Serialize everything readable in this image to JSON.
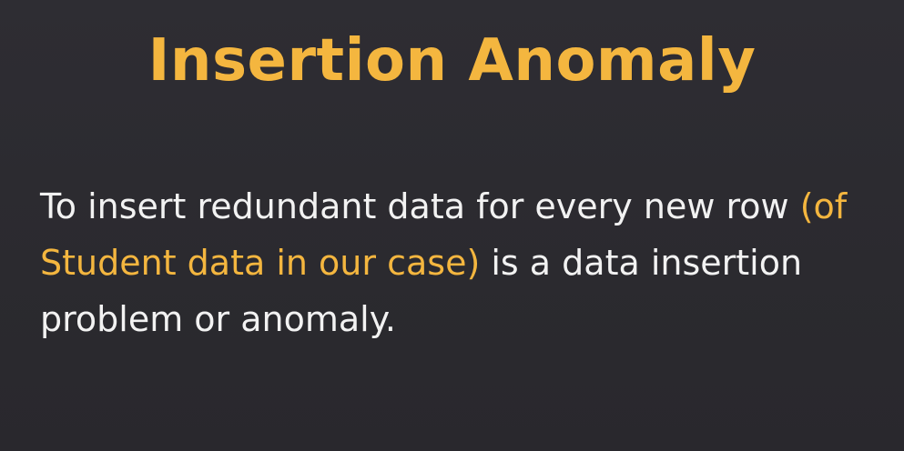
{
  "colors": {
    "background": "#2c2b30",
    "title": "#f4b63f",
    "body": "#f2f2f2",
    "highlight": "#f4b63f"
  },
  "slide": {
    "title": "Insertion Anomaly",
    "body_part1": "To insert redundant data for every new row ",
    "body_highlight": "(of Student data in our case)",
    "body_part2": " is a data insertion problem or anomaly."
  }
}
